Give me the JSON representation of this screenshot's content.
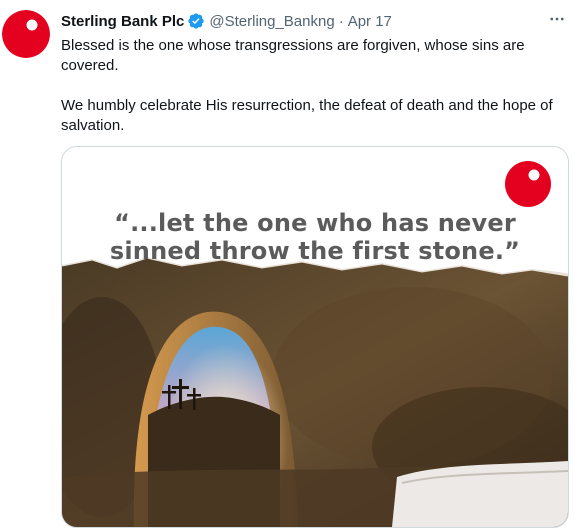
{
  "tweet": {
    "author_name": "Sterling Bank Plc",
    "handle": "@Sterling_Bankng",
    "separator": "·",
    "date": "Apr 17",
    "body_paragraphs": [
      "Blessed is the one whose transgressions are forgiven, whose sins are covered.",
      "We humbly celebrate His resurrection, the defeat of death and the hope of salvation."
    ]
  },
  "media": {
    "quote_lines": [
      "“...let the one who has never",
      "sinned throw the first stone.”"
    ]
  },
  "colors": {
    "brand_red": "#e4001f",
    "verified_blue": "#1d9bf0",
    "quote_gray": "#5b5b5b"
  },
  "icons": {
    "verified": "verified-badge-icon",
    "more": "more-options-icon",
    "logo": "sterling-logo-icon"
  }
}
